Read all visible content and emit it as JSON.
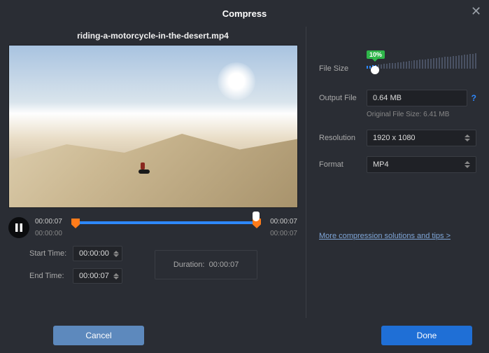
{
  "title": "Compress",
  "filename": "riding-a-motorcycle-in-the-desert.mp4",
  "player": {
    "current": "00:00:07",
    "start": "00:00:00",
    "end_marker": "00:00:07",
    "total": "00:00:07"
  },
  "times": {
    "start_label": "Start Time:",
    "start_value": "00:00:00",
    "end_label": "End Time:",
    "end_value": "00:00:07",
    "duration_label": "Duration:",
    "duration_value": "00:00:07"
  },
  "right": {
    "file_size_label": "File Size",
    "file_size_pct": "10%",
    "output_file_label": "Output File",
    "output_file_value": "0.64 MB",
    "original_size": "Original File Size: 6.41 MB",
    "resolution_label": "Resolution",
    "resolution_value": "1920 x 1080",
    "format_label": "Format",
    "format_value": "MP4",
    "more_link": "More compression solutions and tips >"
  },
  "buttons": {
    "cancel": "Cancel",
    "done": "Done"
  }
}
